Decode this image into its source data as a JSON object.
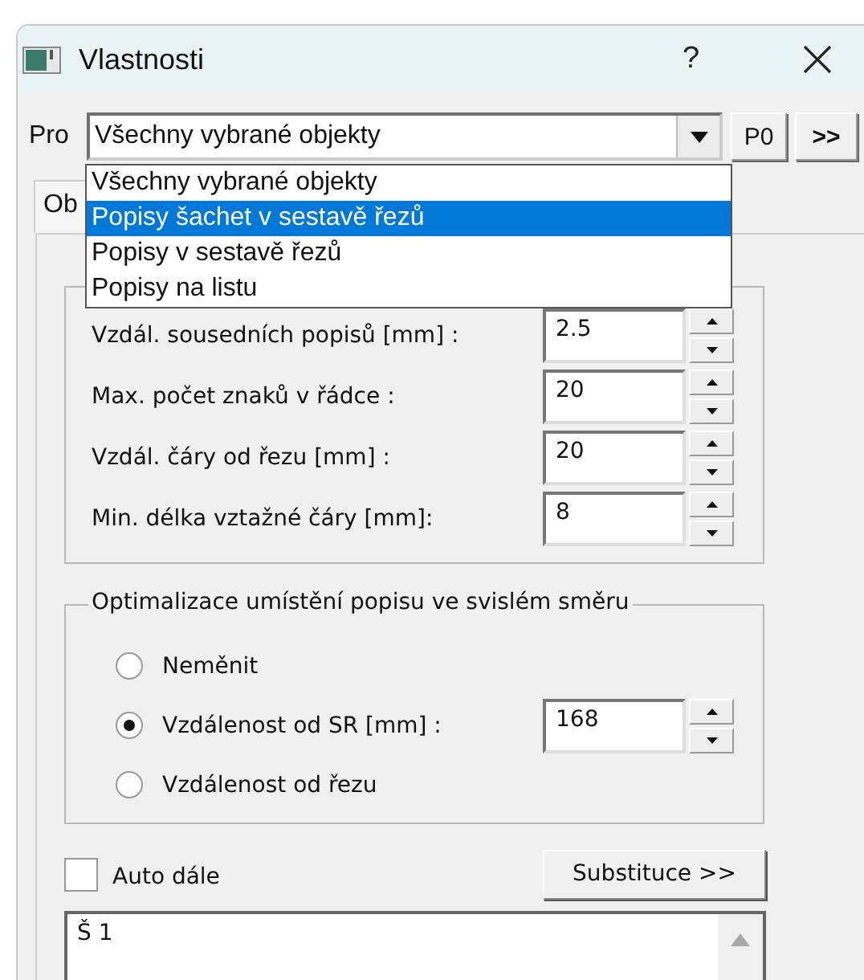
{
  "window": {
    "title": "Vlastnosti",
    "help": "?"
  },
  "target": {
    "label": "Pro",
    "value": "Všechny vybrané objekty",
    "expanded": true
  },
  "dropdown": [
    {
      "label": "Všechny vybrané objekty",
      "selected": false
    },
    {
      "label": "Popisy šachet v sestavě řezů",
      "selected": true
    },
    {
      "label": "Popisy v sestavě řezů",
      "selected": false
    },
    {
      "label": "Popisy na listu",
      "selected": false
    }
  ],
  "buttons": [
    "P0",
    ">>"
  ],
  "tab": {
    "label": "Ob"
  },
  "spacing_rows": [
    {
      "label": "Vzdál. sousedních popisů [mm] :",
      "value": "2.5"
    },
    {
      "label": "Max. počet znaků v řádce :",
      "value": "20"
    },
    {
      "label": "Vzdál. čáry od řezu [mm] :",
      "value": "20"
    },
    {
      "label": "Min. délka vztažné čáry [mm]:",
      "value": "8"
    }
  ],
  "vertical_group": {
    "title": "Optimalizace umístění popisu ve svislém směru",
    "options": [
      {
        "label": "Neměnit",
        "selected": false
      },
      {
        "label": "Vzdálenost od SR [mm] :",
        "selected": true,
        "value": "168"
      },
      {
        "label": "Vzdálenost od řezu",
        "selected": false
      }
    ]
  },
  "auto_next": {
    "label": "Auto dále",
    "checked": false
  },
  "substitute_button": "Substituce >>",
  "text_area": {
    "value": "Š 1"
  }
}
